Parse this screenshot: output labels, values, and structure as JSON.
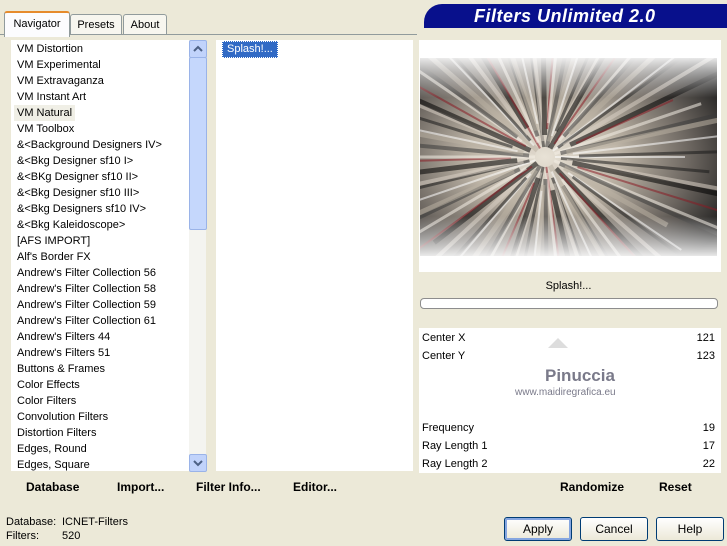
{
  "tabs": [
    "Navigator",
    "Presets",
    "About"
  ],
  "banner_title": "Filters Unlimited 2.0",
  "categories": [
    "VM Distortion",
    "VM Experimental",
    "VM Extravaganza",
    "VM Instant Art",
    "VM Natural",
    "VM Toolbox",
    "&<Background Designers IV>",
    "&<Bkg Designer sf10 I>",
    "&<BKg Designer sf10 II>",
    "&<Bkg Designer sf10 III>",
    "&<Bkg Designers sf10 IV>",
    "&<Bkg Kaleidoscope>",
    "[AFS IMPORT]",
    "Alf's Border FX",
    "Andrew's Filter Collection 56",
    "Andrew's Filter Collection 58",
    "Andrew's Filter Collection 59",
    "Andrew's Filter Collection 61",
    "Andrew's Filters 44",
    "Andrew's Filters 51",
    "Buttons & Frames",
    "Color Effects",
    "Color Filters",
    "Convolution Filters",
    "Distortion Filters",
    "Edges, Round",
    "Edges, Square"
  ],
  "selected_category": "VM Natural",
  "filters": [
    "Splash!..."
  ],
  "filter_name": "Splash!...",
  "params": [
    {
      "label": "Center X",
      "value": "121"
    },
    {
      "label": "Center Y",
      "value": "123"
    },
    {
      "label": "Frequency",
      "value": "19"
    },
    {
      "label": "Ray Length 1",
      "value": "17"
    },
    {
      "label": "Ray Length 2",
      "value": "22"
    }
  ],
  "watermark": {
    "name": "Pinuccia",
    "url": "www.maidiregrafica.eu"
  },
  "toolbar": {
    "database": "Database",
    "import": "Import...",
    "filter_info": "Filter Info...",
    "editor": "Editor...",
    "randomize": "Randomize",
    "reset": "Reset"
  },
  "status": {
    "database_label": "Database:",
    "database_value": "ICNET-Filters",
    "filters_label": "Filters:",
    "filters_value": "520"
  },
  "buttons": {
    "apply": "Apply",
    "cancel": "Cancel",
    "help": "Help"
  }
}
